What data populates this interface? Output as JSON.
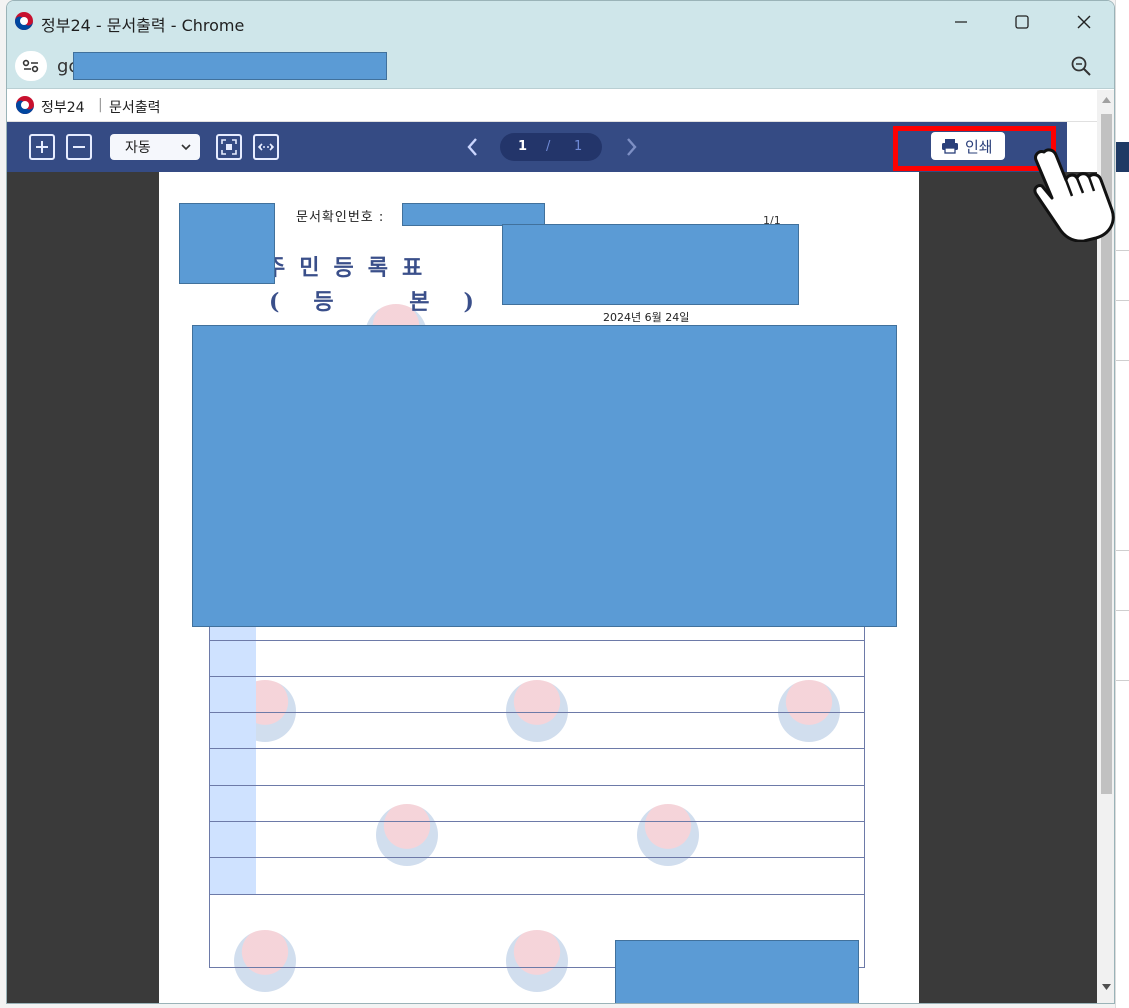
{
  "window": {
    "title": "정부24 - 문서출력 - Chrome"
  },
  "address": {
    "url_visible": "gc"
  },
  "page_header": {
    "brand": "정부24",
    "separator": "|",
    "title": "문서출력"
  },
  "toolbar": {
    "zoom_select": "자동",
    "page_current": "1",
    "page_separator": "/",
    "page_total": "1",
    "print_label": "인쇄"
  },
  "document": {
    "doc_number_label": "문서확인번호 :",
    "page_indicator": "1/1",
    "title_line1": "주민등록표",
    "title_line2": "(등 본)",
    "date": "2024년 6월 24일"
  },
  "colors": {
    "toolbar_bg": "#354b84",
    "redaction": "#5b9bd5",
    "highlight": "#ff0000",
    "titlebar_bg": "#cfe6ea"
  },
  "icons": {
    "logo": "korea-gov-logo-icon",
    "zoom_in": "plus-box-icon",
    "zoom_out": "minus-box-icon",
    "fit_page": "fit-page-icon",
    "fit_width": "fit-width-icon",
    "prev": "chevron-left-icon",
    "next": "chevron-right-icon",
    "print": "printer-icon",
    "cursor": "hand-pointer-icon"
  }
}
